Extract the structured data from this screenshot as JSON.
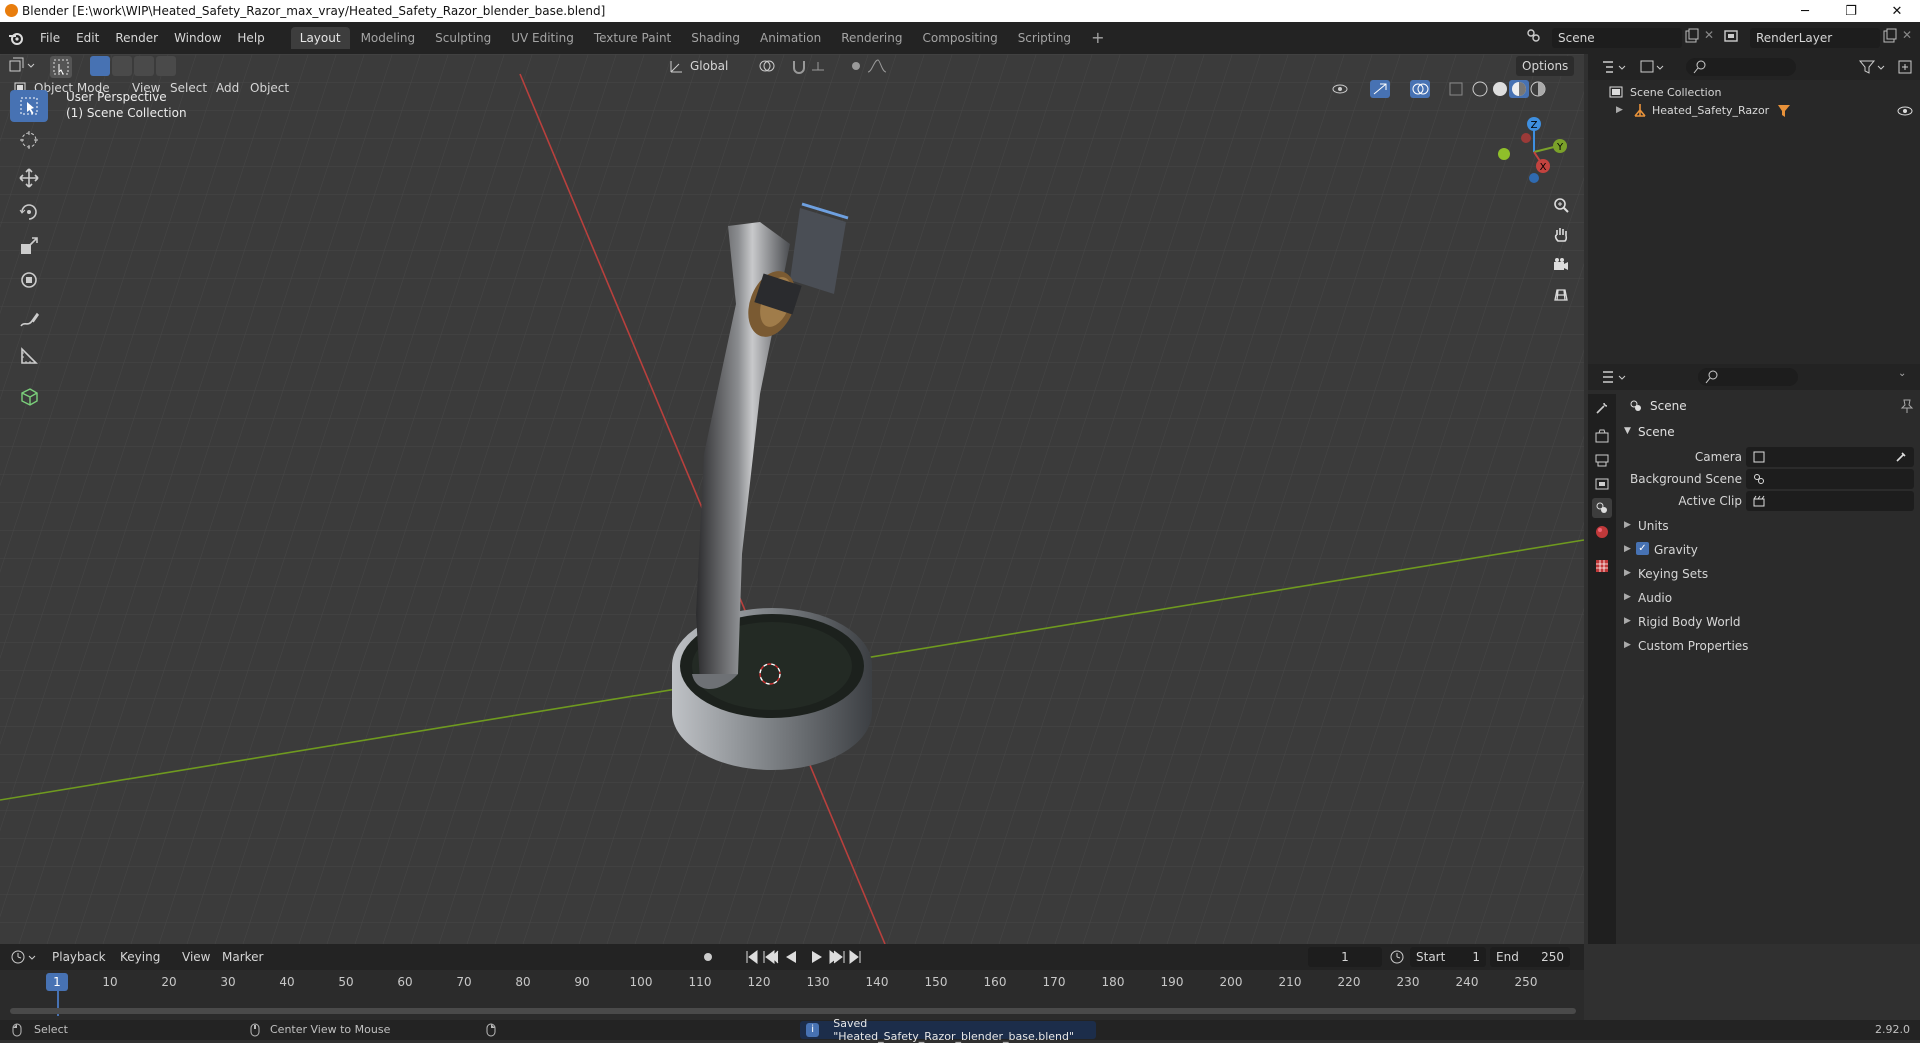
{
  "window": {
    "title": "Blender [E:\\work\\WIP\\Heated_Safety_Razor_max_vray/Heated_Safety_Razor_blender_base.blend]",
    "minimize": "─",
    "maximize": "❐",
    "close": "✕"
  },
  "menu": [
    "File",
    "Edit",
    "Render",
    "Window",
    "Help"
  ],
  "workspaces": [
    "Layout",
    "Modeling",
    "Sculpting",
    "UV Editing",
    "Texture Paint",
    "Shading",
    "Animation",
    "Rendering",
    "Compositing",
    "Scripting"
  ],
  "active_workspace": "Layout",
  "add_workspace": "+",
  "scene_field": "Scene",
  "renderlayer_field": "RenderLayer",
  "viewport": {
    "mode": "Object Mode",
    "menus": [
      "View",
      "Select",
      "Add",
      "Object"
    ],
    "transform_orientation": "Global",
    "options": "Options",
    "overlay_text_1": "User Perspective",
    "overlay_text_2": "(1) Scene Collection",
    "gizmo_axes": [
      "Z",
      "Y",
      "X"
    ]
  },
  "outliner": {
    "root": "Scene Collection",
    "items": [
      {
        "label": "Heated_Safety_Razor"
      }
    ]
  },
  "properties": {
    "header": "Scene",
    "panel": "Scene",
    "fields": [
      {
        "label": "Camera"
      },
      {
        "label": "Background Scene"
      },
      {
        "label": "Active Clip"
      }
    ],
    "subpanels": [
      "Units",
      "Gravity",
      "Keying Sets",
      "Audio",
      "Rigid Body World",
      "Custom Properties"
    ],
    "gravity_checked": true
  },
  "timeline": {
    "menus": [
      "Playback",
      "Keying",
      "View",
      "Marker"
    ],
    "current_frame": "1",
    "start_label": "Start",
    "start_value": "1",
    "end_label": "End",
    "end_value": "250",
    "ticks": [
      "1",
      "10",
      "20",
      "30",
      "40",
      "50",
      "60",
      "70",
      "80",
      "90",
      "100",
      "110",
      "120",
      "130",
      "140",
      "150",
      "160",
      "170",
      "180",
      "190",
      "200",
      "210",
      "220",
      "230",
      "240",
      "250"
    ]
  },
  "status": {
    "select": "Select",
    "center_view": "Center View to Mouse",
    "message": "Saved \"Heated_Safety_Razor_blender_base.blend\"",
    "version": "2.92.0"
  },
  "colors": {
    "accent": "#4772b3",
    "x_axis": "#c2433f",
    "y_axis": "#7ba12a",
    "z_axis": "#3e8fe0"
  }
}
